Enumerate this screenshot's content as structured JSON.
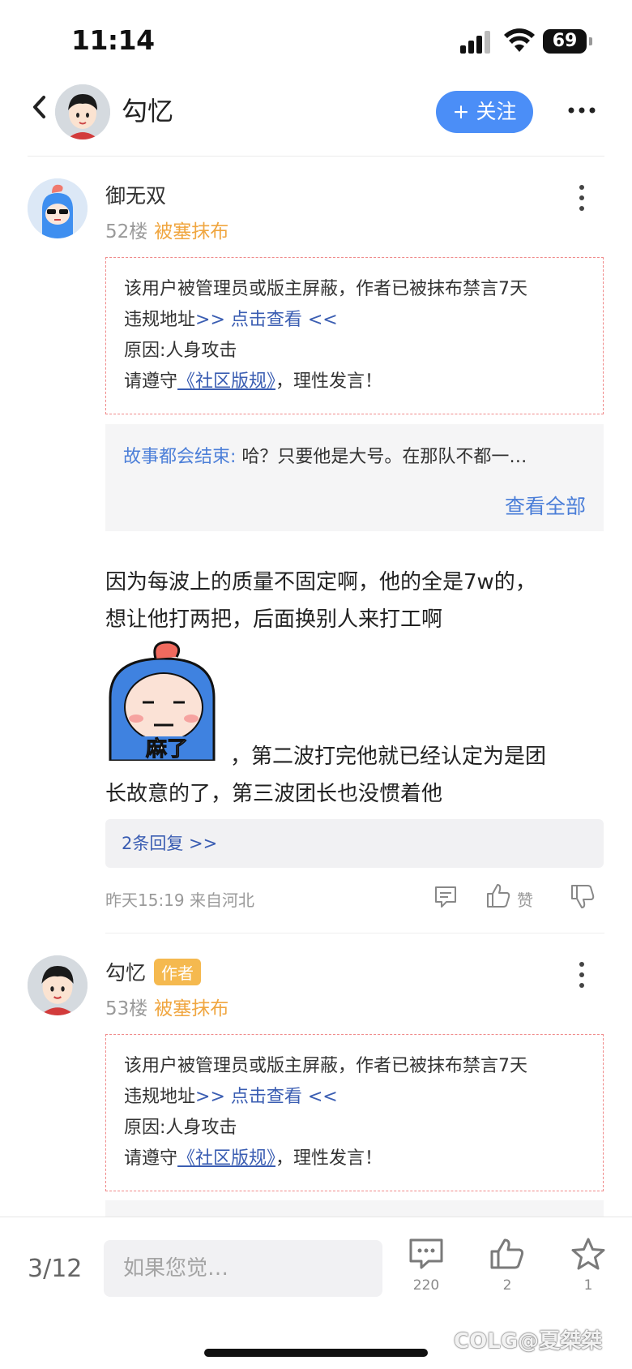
{
  "status": {
    "time": "11:14",
    "battery": "69"
  },
  "header": {
    "name": "勾忆",
    "follow_label": "+ 关注"
  },
  "posts": [
    {
      "author": "御无双",
      "floor": "52楼",
      "ban_status": "被塞抹布",
      "notice": {
        "line1": "该用户被管理员或版主屏蔽，作者已被抹布禁言7天",
        "line2_prefix": "违规地址",
        "line2_link": ">> 点击查看 <<",
        "line3": "原因:人身攻击",
        "line4_prefix": "请遵守",
        "line4_link": "《社区版规》",
        "line4_suffix": "，理性发言！"
      },
      "quote": {
        "user": "故事都会结束:",
        "text": " 哈？只要他是大号。在那队不都一…",
        "more": "查看全部"
      },
      "body_line1": "因为每波上的质量不固定啊，他的全是7w的，",
      "body_line2": "想让他打两把，后面换别人来打工啊",
      "sticker_text": "麻了",
      "body_after_sticker": "，第二波打完他就已经认定为是团",
      "body_line4": "长故意的了，第三波团长也没惯着他",
      "replies": "2条回复 >>",
      "meta": "昨天15:19 来自河北",
      "like_label": "赞"
    },
    {
      "author": "勾忆",
      "author_badge": "作者",
      "floor": "53楼",
      "ban_status": "被塞抹布",
      "notice": {
        "line1": "该用户被管理员或版主屏蔽，作者已被抹布禁言7天",
        "line2_prefix": "违规地址",
        "line2_link": ">> 点击查看 <<",
        "line3": "原因:人身攻击",
        "line4_prefix": "请遵守",
        "line4_link": "《社区版规》",
        "line4_suffix": "，理性发言！"
      }
    }
  ],
  "bottom_bar": {
    "page": "3/12",
    "placeholder": "如果您觉…",
    "comments": "220",
    "likes": "2",
    "favorites": "1"
  },
  "watermark": "COLG@夏桀桀",
  "colors": {
    "accent": "#4b8ef7",
    "link": "#3a5db2",
    "ban": "#f0a640",
    "notice_border": "#f08a8a"
  }
}
